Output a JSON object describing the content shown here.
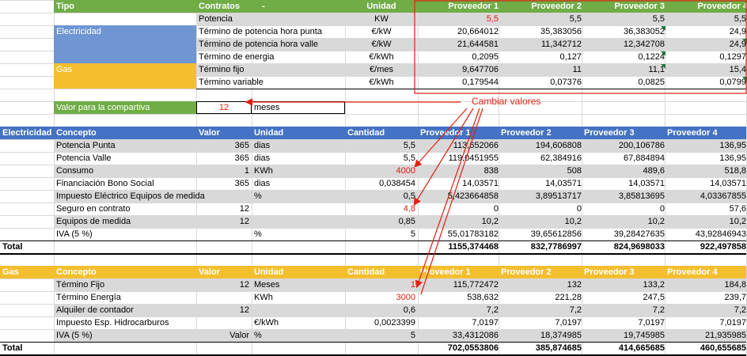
{
  "top": {
    "headers": [
      "Tipo",
      "Contratos",
      "-",
      "Unidad",
      "Proveedor 1",
      "Proveedor 2",
      "Proveedor 3",
      "Proveedor 4"
    ],
    "label_electricidad": "Electricidad",
    "label_gas": "Gas",
    "rows": [
      {
        "concepto": "Potencia",
        "unidad": "KW",
        "p": [
          "5,5",
          "5,5",
          "5,5",
          "5,5"
        ]
      },
      {
        "concepto": "Término de potencia hora punta",
        "unidad": "€/kW",
        "p": [
          "20,664012",
          "35,383056",
          "36,383052",
          "24,9"
        ]
      },
      {
        "concepto": "Término de potencia hora valle",
        "unidad": "€/kW",
        "p": [
          "21,644581",
          "11,342712",
          "12,342708",
          "24,9"
        ]
      },
      {
        "concepto": "Término de energia",
        "unidad": "€/kWh",
        "p": [
          "0,2095",
          "0,127",
          "0,1224",
          "0,1297"
        ]
      },
      {
        "concepto": "Término fijo",
        "unidad": "€/mes",
        "p": [
          "9,647706",
          "11",
          "11,1",
          "15,4"
        ]
      },
      {
        "concepto": "Término variable",
        "unidad": "€/kWh",
        "p": [
          "0,179544",
          "0,07376",
          "0,0825",
          "0,0799"
        ]
      }
    ],
    "valor_label": "Valor para la compartiva",
    "valor_value": "12",
    "valor_unit": "meses",
    "annotation": "Cambiar valores"
  },
  "elec": {
    "headers": [
      "Electricidad",
      "Concepto",
      "Valor",
      "Unidad",
      "Cantidad",
      "Proveedor 1",
      "Proveedor 2",
      "Proveedor 3",
      "Proveedor 4"
    ],
    "rows": [
      {
        "concepto": "Potencia Punta",
        "valor": "365",
        "unidad": "dias",
        "cantidad": "5,5",
        "p": [
          "113,652066",
          "194,606808",
          "200,106786",
          "136,95"
        ]
      },
      {
        "concepto": "Potencia Valle",
        "valor": "365",
        "unidad": "dias",
        "cantidad": "5,5",
        "p": [
          "119,0451955",
          "62,384916",
          "67,884894",
          "136,95"
        ]
      },
      {
        "concepto": "Consumo",
        "valor": "1",
        "unidad": "KWh",
        "cantidad": "4000",
        "p": [
          "838",
          "508",
          "489,6",
          "518,8"
        ]
      },
      {
        "concepto": "Financiación Bono Social",
        "valor": "365",
        "unidad": "dias",
        "cantidad": "0,038454",
        "p": [
          "14,03571",
          "14,03571",
          "14,03571",
          "14,03571"
        ]
      },
      {
        "concepto": "Impuesto Eléctrico Equipos de medida",
        "valor": "",
        "unidad": "%",
        "cantidad": "0,5",
        "p": [
          "5,423664858",
          "3,89513717",
          "3,85813695",
          "4,03367855"
        ]
      },
      {
        "concepto": "Seguro en contrato",
        "valor": "12",
        "unidad": "",
        "cantidad": "4,8",
        "p": [
          "0",
          "0",
          "0",
          "57,6"
        ]
      },
      {
        "concepto": "Equipos de medida",
        "valor": "12",
        "unidad": "",
        "cantidad": "0,85",
        "p": [
          "10,2",
          "10,2",
          "10,2",
          "10,2"
        ]
      },
      {
        "concepto": "IVA (5 %)",
        "valor": "",
        "unidad": "%",
        "cantidad": "5",
        "p": [
          "55,01783182",
          "39,65612856",
          "39,28427635",
          "43,92846943"
        ]
      }
    ],
    "total_label": "Total",
    "totals": [
      "1155,374468",
      "832,7786997",
      "824,9698033",
      "922,497858"
    ]
  },
  "gas": {
    "headers": [
      "Gas",
      "Concepto",
      "Valor",
      "Unidad",
      "Cantidad",
      "Proveedor 1",
      "Proveedor 2",
      "Proveedor 3",
      "Proveedor 4"
    ],
    "rows": [
      {
        "concepto": "Término Fijo",
        "valor": "12",
        "unidad": "Meses",
        "cantidad": "1",
        "p": [
          "115,772472",
          "132",
          "133,2",
          "184,8"
        ]
      },
      {
        "concepto": "Término Energía",
        "valor": "",
        "unidad": "KWh",
        "cantidad": "3000",
        "p": [
          "538,632",
          "221,28",
          "247,5",
          "239,7"
        ]
      },
      {
        "concepto": "Alquiler de contador",
        "valor": "12",
        "unidad": "",
        "cantidad": "0,6",
        "p": [
          "7,2",
          "7,2",
          "7,2",
          "7,2"
        ]
      },
      {
        "concepto": "Impuesto Esp. Hidrocarburos",
        "valor": "",
        "unidad": "€/kWh",
        "cantidad": "0,0023399",
        "p": [
          "7,0197",
          "7,0197",
          "7,0197",
          "7,0197"
        ]
      },
      {
        "concepto": "IVA (5 %)",
        "valor": "Valor",
        "unidad": "%",
        "cantidad": "5",
        "p": [
          "33,4312086",
          "18,374985",
          "19,745985",
          "21,935985"
        ]
      }
    ],
    "total_label": "Total",
    "totals": [
      "702,0553806",
      "385,874685",
      "414,665685",
      "460,655685"
    ]
  },
  "colors": {
    "green": "#70ad47",
    "blue": "#4472c4",
    "yellow": "#f4bf2f",
    "red": "#e02010",
    "grey": "#d9d9d9"
  }
}
